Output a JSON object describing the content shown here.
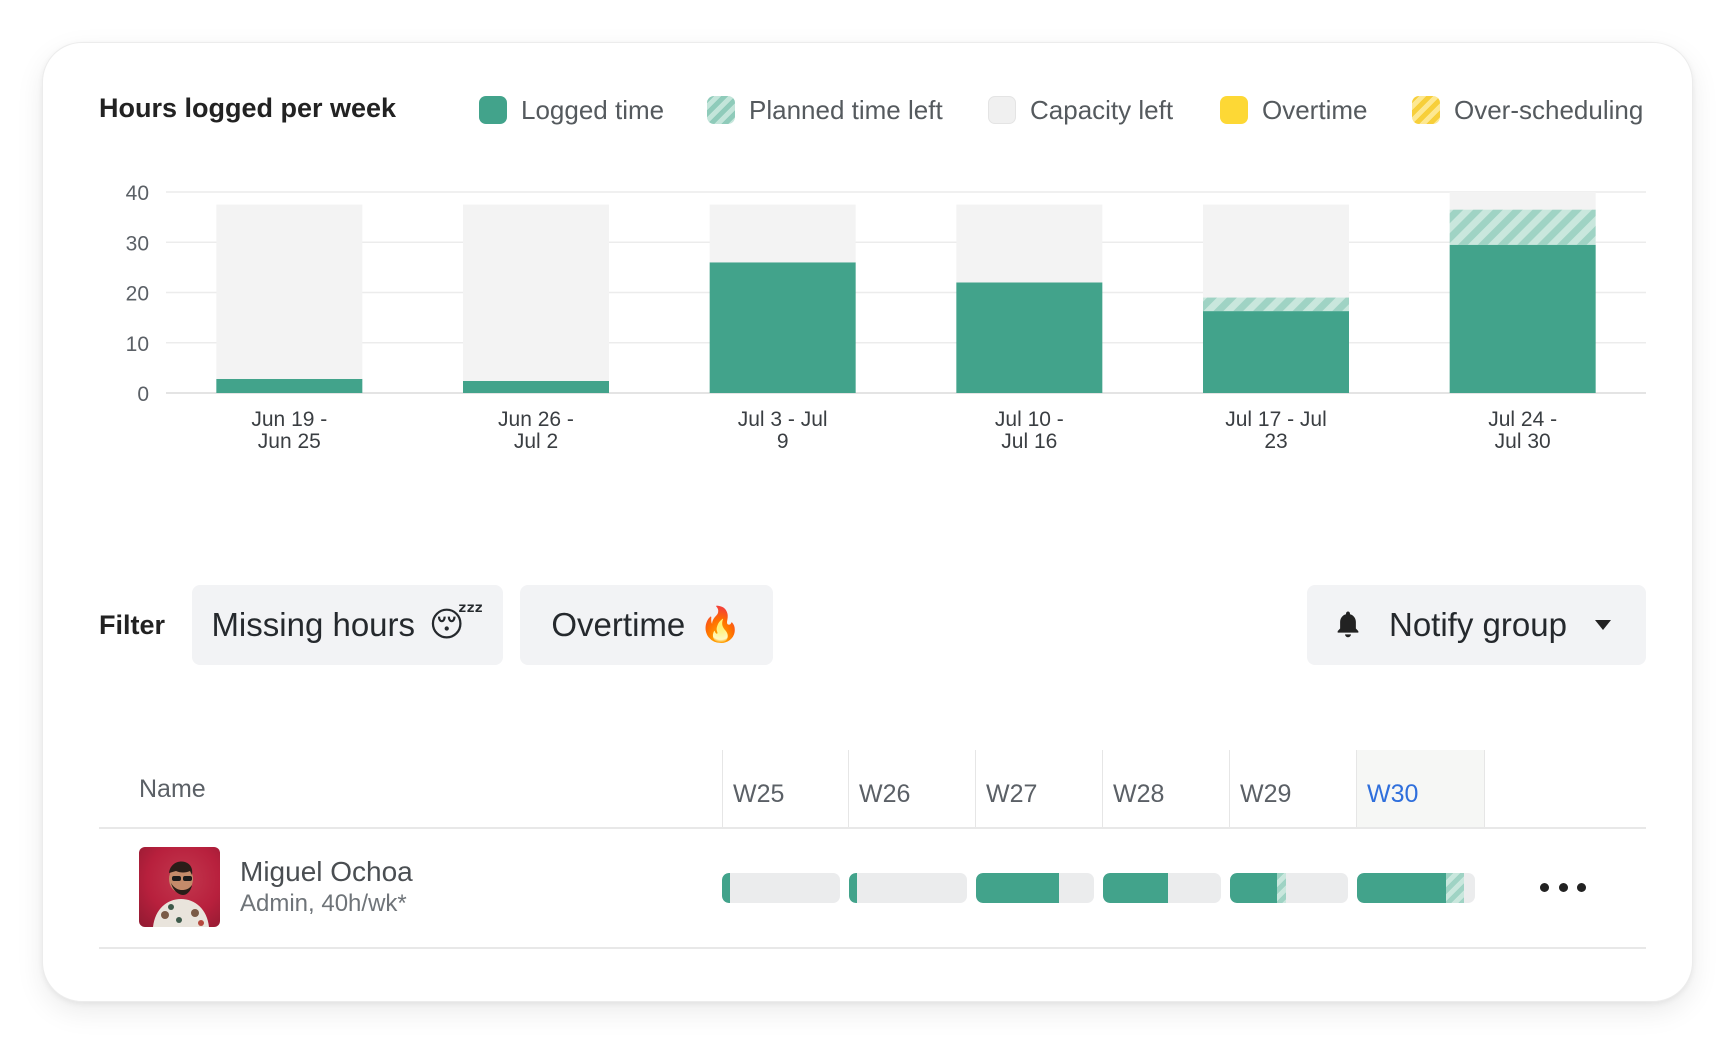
{
  "chart_data": {
    "type": "bar",
    "title": "Hours logged per week",
    "categories": [
      [
        "Jun 19 -",
        "Jun 25"
      ],
      [
        "Jun 26 -",
        "Jul 2"
      ],
      [
        "Jul 3 - Jul",
        "9"
      ],
      [
        "Jul 10 -",
        "Jul 16"
      ],
      [
        "Jul 17 - Jul",
        "23"
      ],
      [
        "Jul 24 -",
        "Jul 30"
      ]
    ],
    "ylim": [
      0,
      40
    ],
    "yticks": [
      0,
      10,
      20,
      30,
      40
    ],
    "grid": true,
    "stacked": true,
    "series": [
      {
        "name": "Logged time",
        "values": [
          2.8,
          2.4,
          26,
          22,
          16.3,
          29.5
        ],
        "color": "#42a38b",
        "pattern": "solid"
      },
      {
        "name": "Planned time left",
        "values": [
          0,
          0,
          0,
          0,
          2.7,
          7
        ],
        "color": "#9fd3c4",
        "pattern": "striped"
      },
      {
        "name": "Capacity left",
        "values": [
          34.7,
          35.1,
          11.5,
          15.5,
          18.5,
          3.5
        ],
        "color": "#f3f3f3",
        "pattern": "solid"
      }
    ]
  },
  "legend": [
    {
      "label": "Logged time",
      "color": "#42a38b",
      "pattern": "solid"
    },
    {
      "label": "Planned time left",
      "color": "#a9dacb",
      "pattern": "striped"
    },
    {
      "label": "Capacity left",
      "color": "#f0f0f0",
      "pattern": "solid"
    },
    {
      "label": "Overtime",
      "color": "#fdd835",
      "pattern": "solid"
    },
    {
      "label": "Over-scheduling",
      "color": "#fde06b",
      "pattern": "striped"
    }
  ],
  "filter": {
    "label": "Filter",
    "chips": [
      {
        "label": "Missing hours",
        "emoji": "😴"
      },
      {
        "label": "Overtime",
        "emoji": "🔥"
      }
    ],
    "notify_label": "Notify group",
    "notify_icon": "bell-icon"
  },
  "table": {
    "name_header": "Name",
    "weeks": [
      "W25",
      "W26",
      "W27",
      "W28",
      "W29",
      "W30"
    ],
    "current_week": "W30",
    "rows": [
      {
        "name": "Miguel Ochoa",
        "subtitle": "Admin, 40h/wk*",
        "week_logged_pct": [
          7,
          7,
          70,
          55,
          40,
          75
        ],
        "week_planned_pct": [
          0,
          0,
          0,
          0,
          8,
          15
        ]
      }
    ]
  }
}
